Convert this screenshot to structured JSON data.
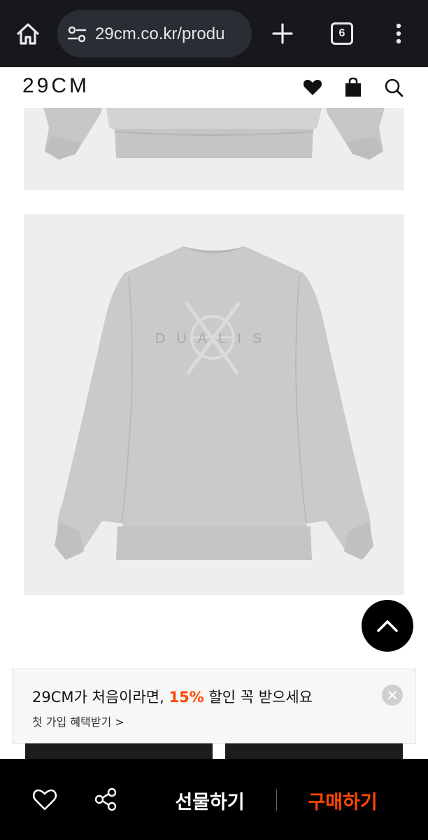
{
  "browser": {
    "url": "29cm.co.kr/produ",
    "tab_count": "6"
  },
  "header": {
    "logo": "29CM"
  },
  "promo": {
    "headline_before": "29CM가 처음이라면, ",
    "headline_accent": "15%",
    "headline_after": " 할인 꼭 받으세요",
    "link": "첫 가입 혜택받기 >"
  },
  "bottom_bar": {
    "gift_label": "선물하기",
    "buy_label": "구매하기"
  },
  "colors": {
    "accent": "#ff4800",
    "chrome_bg": "#16181c",
    "bottom_bar_bg": "#000000"
  }
}
